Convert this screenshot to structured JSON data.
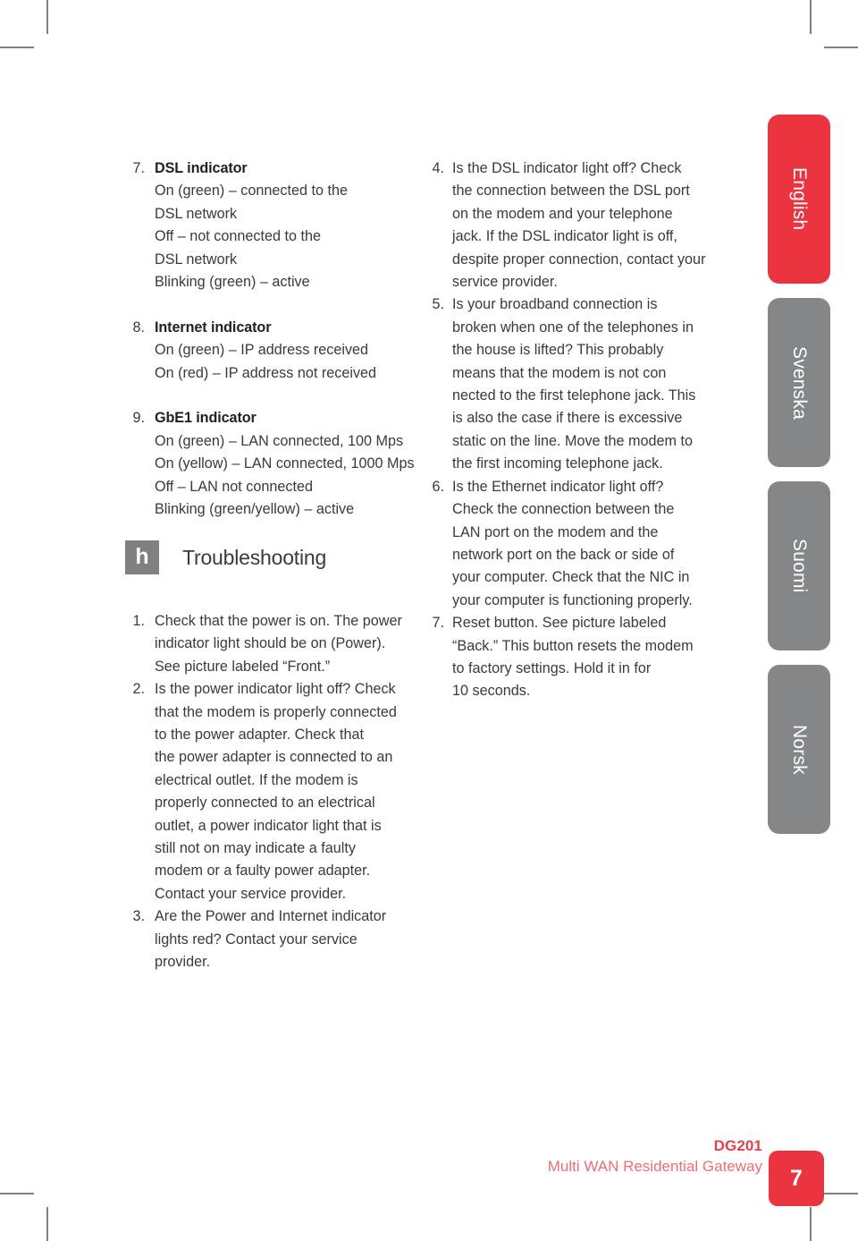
{
  "language_tabs": [
    {
      "label": "English",
      "active": true,
      "color": "#ec3440"
    },
    {
      "label": "Svenska",
      "active": false,
      "color": "#858688"
    },
    {
      "label": "Suomi",
      "active": false,
      "color": "#858688"
    },
    {
      "label": "Norsk",
      "active": false,
      "color": "#858688"
    }
  ],
  "left_column": {
    "indicators": [
      {
        "num": "7.",
        "title": "DSL indicator",
        "lines": [
          "On (green) – connected to the",
          "DSL network",
          "Off – not connected to the",
          "DSL network",
          "Blinking (green) – active"
        ]
      },
      {
        "num": "8.",
        "title": "Internet indicator",
        "lines": [
          "On (green) – IP address received",
          "On (red) – IP address not received"
        ]
      },
      {
        "num": "9.",
        "title": "GbE1 indicator",
        "lines": [
          "On (green) – LAN connected, 100 Mps",
          "On (yellow) – LAN connected, 1000 Mps",
          "Off – LAN not connected",
          "Blinking (green/yellow) – active"
        ]
      }
    ]
  },
  "troubleshooting": {
    "badge_glyph": "h",
    "heading": "Troubleshooting",
    "steps_left": [
      {
        "num": "1.",
        "lines": [
          "Check that the power is on. The power",
          "indicator light should be on (Power).",
          "See picture labeled “Front.”"
        ]
      },
      {
        "num": "2.",
        "lines": [
          "Is the power indicator light off? Check",
          "that the modem is properly connected",
          "to the power adapter. Check that",
          "the power adapter is connected to an",
          "electrical outlet. If the modem is",
          "properly connected to an electrical",
          "outlet, a power indicator light that is",
          "still not on may indicate a faulty",
          "modem or a faulty power adapter.",
          "Contact your service provider."
        ]
      },
      {
        "num": "3.",
        "lines": [
          "Are the Power and Internet indicator",
          "lights red? Contact your service",
          "provider."
        ]
      }
    ],
    "steps_right": [
      {
        "num": "4.",
        "lines": [
          "Is the DSL indicator light off? Check",
          "the connection between the DSL port",
          "on the modem and your telephone",
          "jack. If the DSL indicator light is off,",
          "despite proper connection, contact your",
          "service provider."
        ]
      },
      {
        "num": "5.",
        "lines": [
          "Is your broadband connection is",
          "broken when one of the telephones in",
          "the house is lifted? This probably",
          "means that the modem is not con",
          "nected to the first telephone jack. This",
          "is also the case if there is excessive",
          "static on the line. Move the modem to",
          "the first incoming telephone jack."
        ]
      },
      {
        "num": "6.",
        "lines": [
          "Is the Ethernet indicator light off?",
          "Check the connection between the",
          "LAN port on the modem and the",
          "network port on the back or side of",
          "your computer. Check that the NIC in",
          "your computer is functioning properly."
        ]
      },
      {
        "num": "7.",
        "lines": [
          "Reset button. See picture labeled",
          "“Back.” This button resets the modem",
          "to factory settings. Hold it in for",
          "10 seconds."
        ]
      }
    ]
  },
  "footer": {
    "model": "DG201",
    "subtitle": "Multi WAN Residential Gateway",
    "page_number": "7",
    "model_color": "#e0434f",
    "subtitle_color": "#ef6d74",
    "badge_color": "#ec3440"
  }
}
